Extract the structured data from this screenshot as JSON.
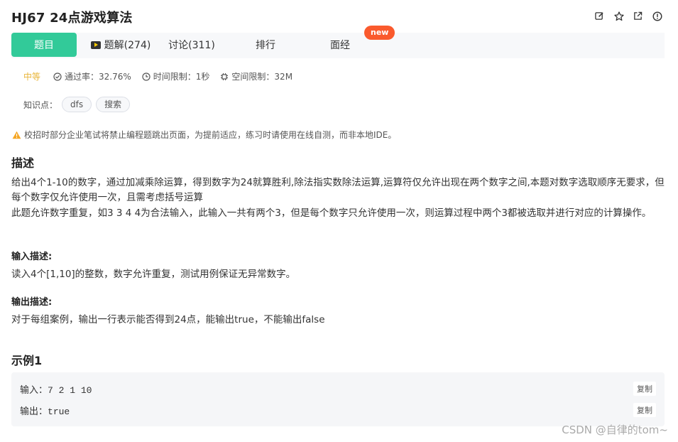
{
  "title": "HJ67  24点游戏算法",
  "tabs": [
    {
      "label": "题目"
    },
    {
      "label": "题解(274)"
    },
    {
      "label": "讨论(311)"
    },
    {
      "label": "排行"
    },
    {
      "label": "面经"
    }
  ],
  "new_badge": "new",
  "meta": {
    "difficulty": "中等",
    "pass_rate": "通过率：32.76%",
    "time_limit": "时间限制：1秒",
    "space_limit": "空间限制：32M"
  },
  "knowledge": {
    "label": "知识点：",
    "tags": [
      "dfs",
      "搜索"
    ]
  },
  "notice": "校招时部分企业笔试将禁止编程题跳出页面，为提前适应，练习时请使用在线自测，而非本地IDE。",
  "description": {
    "heading": "描述",
    "line1": "给出4个1-10的数字，通过加减乘除运算，得到数字为24就算胜利,除法指实数除法运算,运算符仅允许出现在两个数字之间,本题对数字选取顺序无要求，但每个数字仅允许使用一次，且需考虑括号运算",
    "line2": "此题允许数字重复，如3 3 4 4为合法输入，此输入一共有两个3，但是每个数字只允许使用一次，则运算过程中两个3都被选取并进行对应的计算操作。"
  },
  "input_desc": {
    "heading": "输入描述:",
    "text": "读入4个[1,10]的整数，数字允许重复，测试用例保证无异常数字。"
  },
  "output_desc": {
    "heading": "输出描述:",
    "text": "对于每组案例，输出一行表示能否得到24点，能输出true，不能输出false"
  },
  "example": {
    "heading": "示例1",
    "input_label": "输入：",
    "input_value": "7 2 1 10",
    "output_label": "输出：",
    "output_value": "true",
    "copy_label": "复制"
  },
  "watermark": "CSDN @自律的tom~",
  "colors": {
    "accent": "#32ca99",
    "badge": "#fa5a2d",
    "difficulty": "#e8b53a",
    "warning": "#f5a623"
  }
}
